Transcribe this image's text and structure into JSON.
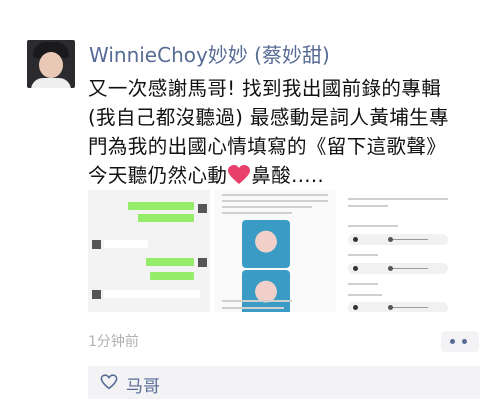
{
  "post": {
    "username": "WinnieChoy妙妙 (蔡妙甜)",
    "text_lines": [
      "又一次感謝馬哥! 找到我出國前錄的專輯",
      "(我自己都沒聽過) 最感動是詞人黃埔生專",
      "門為我的出國心情填寫的《留下這歌聲》",
      "今天聽仍然心動",
      "鼻酸....."
    ],
    "timestamp": "1分钟前"
  },
  "likes": {
    "names": "马哥"
  },
  "icons": {
    "heart": "heart-icon",
    "like": "heart-outline-icon",
    "more": "more-dots-icon"
  },
  "colors": {
    "link": "#576b95",
    "timestamp": "#b2b2b2",
    "heart": "#e8406a",
    "like_bg": "#f3f3f5"
  }
}
